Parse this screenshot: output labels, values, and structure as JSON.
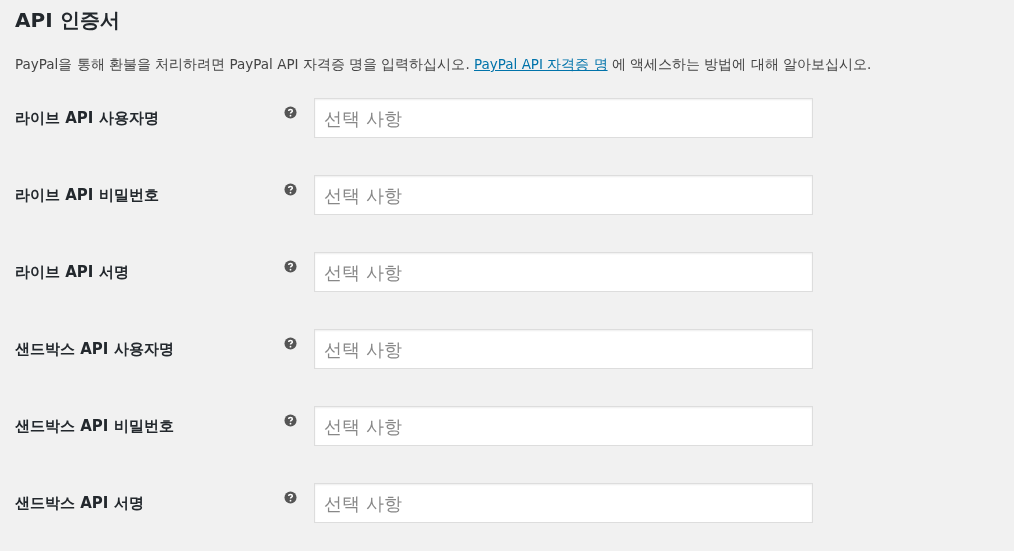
{
  "heading": "API 인증서",
  "description": {
    "before": "PayPal을 통해 환불을 처리하려면 PayPal API 자격증 명을 입력하십시오.",
    "link": "PayPal API 자격증 명",
    "after": "에 액세스하는 방법에 대해 알아보십시오."
  },
  "fields": [
    {
      "label": "라이브 API 사용자명",
      "placeholder": "선택 사항"
    },
    {
      "label": "라이브 API 비밀번호",
      "placeholder": "선택 사항"
    },
    {
      "label": "라이브 API 서명",
      "placeholder": "선택 사항"
    },
    {
      "label": "샌드박스 API 사용자명",
      "placeholder": "선택 사항"
    },
    {
      "label": "샌드박스 API 비밀번호",
      "placeholder": "선택 사항"
    },
    {
      "label": "샌드박스 API 서명",
      "placeholder": "선택 사항"
    }
  ]
}
